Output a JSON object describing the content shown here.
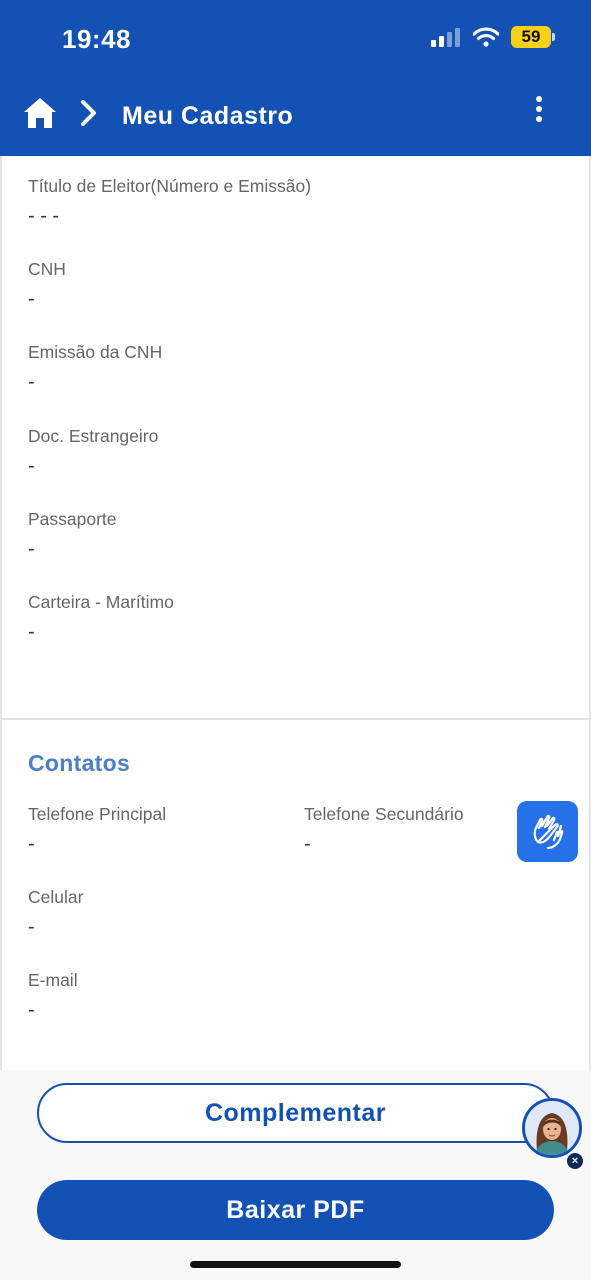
{
  "status_bar": {
    "time": "19:48",
    "battery": "59"
  },
  "navbar": {
    "title": "Meu Cadastro"
  },
  "documents": [
    {
      "label": "Título de Eleitor(Número e Emissão)",
      "value": "- - -"
    },
    {
      "label": "CNH",
      "value": "-"
    },
    {
      "label": "Emissão da CNH",
      "value": "-"
    },
    {
      "label": "Doc. Estrangeiro",
      "value": "-"
    },
    {
      "label": "Passaporte",
      "value": "-"
    },
    {
      "label": "Carteira - Marítimo",
      "value": "-"
    }
  ],
  "contacts": {
    "title": "Contatos",
    "phone_main": {
      "label": "Telefone Principal",
      "value": "-"
    },
    "phone_secondary": {
      "label": "Telefone Secundário",
      "value": "-"
    },
    "mobile": {
      "label": "Celular",
      "value": "-"
    },
    "email": {
      "label": "E-mail",
      "value": "-"
    }
  },
  "footer": {
    "complement_label": "Complementar",
    "download_label": "Baixar PDF",
    "close_glyph": "×"
  },
  "icons": {
    "home": "home-icon",
    "chevron": "chevron-right-icon",
    "menu": "more-vertical-icon",
    "libras": "sign-language-icon",
    "avatar": "assistant-avatar"
  },
  "colors": {
    "primary": "#1351b4",
    "section_title": "#4a80c8",
    "libras": "#2670e8",
    "battery": "#f7d117"
  }
}
